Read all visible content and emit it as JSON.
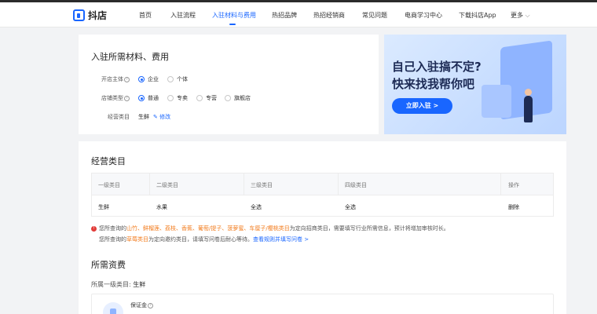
{
  "nav": {
    "logo_text": "抖店",
    "items": [
      "首页",
      "入驻流程",
      "入驻材料与费用",
      "热招品牌",
      "热招经销商",
      "常见问题",
      "电商学习中心",
      "下载抖店App",
      "更多"
    ]
  },
  "materials": {
    "title": "入驻所需材料、费用",
    "entity_label": "开店主体",
    "entity_options": [
      "企业",
      "个体"
    ],
    "shop_type_label": "店铺类型",
    "shop_type_options": [
      "普通",
      "专卖",
      "专营",
      "旗舰店"
    ],
    "category_label": "经营类目",
    "category_value": "生鲜",
    "edit_label": "修改"
  },
  "banner": {
    "line1": "自己入驻搞不定?",
    "line2": "快来找我帮你吧",
    "button": "立即入驻 >"
  },
  "categories": {
    "title": "经营类目",
    "headers": [
      "一级类目",
      "二级类目",
      "三级类目",
      "四级类目",
      "操作"
    ],
    "row": [
      "生鲜",
      "水果",
      "全选",
      "全选",
      "删除"
    ]
  },
  "notice": {
    "line1_prefix": "您所查询的",
    "line1_highlight": "山竹、鲜榴莲、荔枝、香蕉、葡萄/提子、菠萝蜜、车厘子/樱桃类目",
    "line1_suffix": "为定向招商类目，需要填写行业所需信息，预计将增加审核时长。",
    "line2_prefix": "您所查询的",
    "line2_highlight": "草莓类目",
    "line2_suffix": "为定向邀约类目，请填写问卷后耐心等待。",
    "line2_link": "查看规则并填写问卷 >"
  },
  "fees": {
    "title": "所需资费",
    "primary_category_label": "所属一级类目:",
    "primary_category_value": "生鲜",
    "deposit_label": "保证金"
  }
}
